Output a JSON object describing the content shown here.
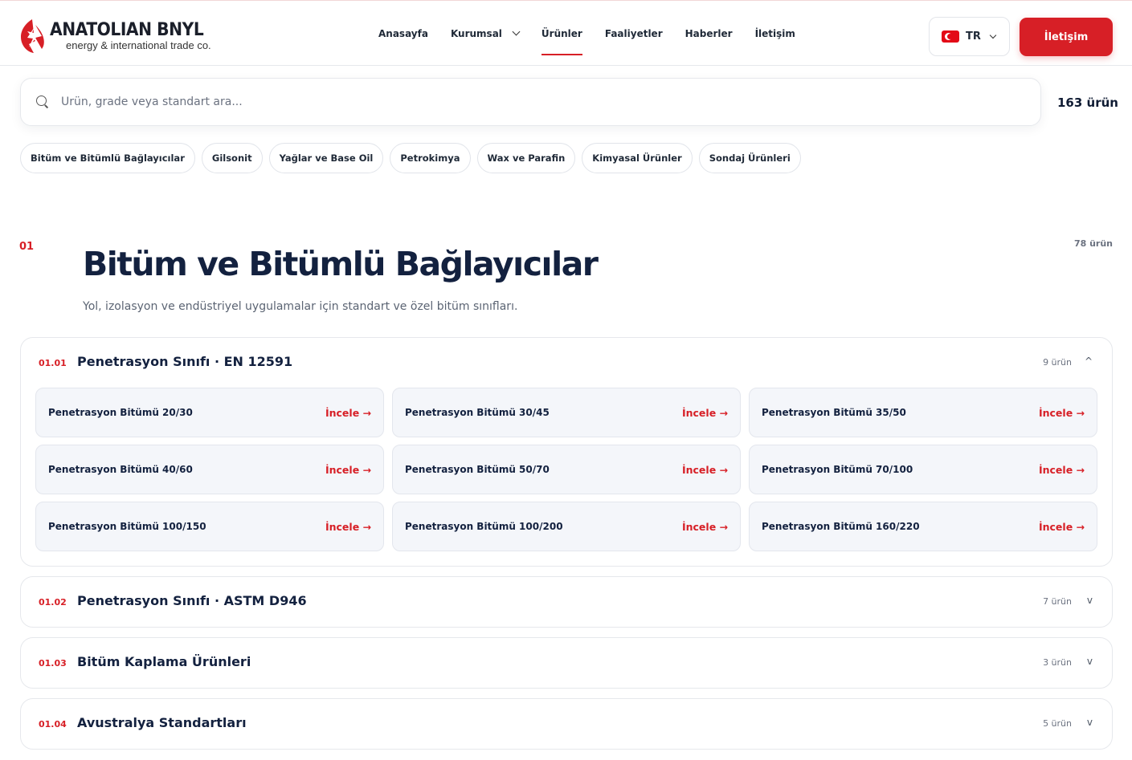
{
  "brand": {
    "name": "ANATOLIAN BNYL",
    "tagline": "energy & international trade co."
  },
  "nav": {
    "items": [
      {
        "label": "Anasayfa"
      },
      {
        "label": "Kurumsal"
      },
      {
        "label": "Ürünler"
      },
      {
        "label": "Faaliyetler"
      },
      {
        "label": "Haberler"
      },
      {
        "label": "İletişim"
      }
    ],
    "active": "Ürünler"
  },
  "language": {
    "code": "TR",
    "flag_icon": "turkey-flag-icon"
  },
  "cta": {
    "label": "İletişim"
  },
  "colors": {
    "accent": "#d71f26",
    "title": "#13213f"
  },
  "search": {
    "placeholder": "Ürün, grade veya standart ara...",
    "value": "",
    "total_label": "163 ürün"
  },
  "categories": [
    "Bitüm ve Bitümlü Bağlayıcılar",
    "Gilsonit",
    "Yağlar ve Base Oil",
    "Petrokimya",
    "Wax ve Parafin",
    "Kimyasal Ürünler",
    "Sondaj Ürünleri"
  ],
  "section": {
    "number": "01",
    "title": "Bitüm ve Bitümlü Bağlayıcılar",
    "description": "Yol, izolasyon ve endüstriyel uygulamalar için standart ve özel bitüm sınıfları.",
    "count": "78 ürün"
  },
  "groups": [
    {
      "number": "01.01",
      "title": "Penetrasyon Sınıfı · EN 12591",
      "count": "9 ürün",
      "toggle": "^",
      "expanded": true,
      "link_label": "İncele →",
      "products": [
        "Penetrasyon Bitümü 20/30",
        "Penetrasyon Bitümü 30/45",
        "Penetrasyon Bitümü 35/50",
        "Penetrasyon Bitümü 40/60",
        "Penetrasyon Bitümü 50/70",
        "Penetrasyon Bitümü 70/100",
        "Penetrasyon Bitümü 100/150",
        "Penetrasyon Bitümü 100/200",
        "Penetrasyon Bitümü 160/220"
      ]
    },
    {
      "number": "01.02",
      "title": "Penetrasyon Sınıfı · ASTM D946",
      "count": "7 ürün",
      "toggle": "v",
      "expanded": false
    },
    {
      "number": "01.03",
      "title": "Bitüm Kaplama Ürünleri",
      "count": "3 ürün",
      "toggle": "v",
      "expanded": false
    },
    {
      "number": "01.04",
      "title": "Avustralya Standartları",
      "count": "5 ürün",
      "toggle": "v",
      "expanded": false
    }
  ]
}
